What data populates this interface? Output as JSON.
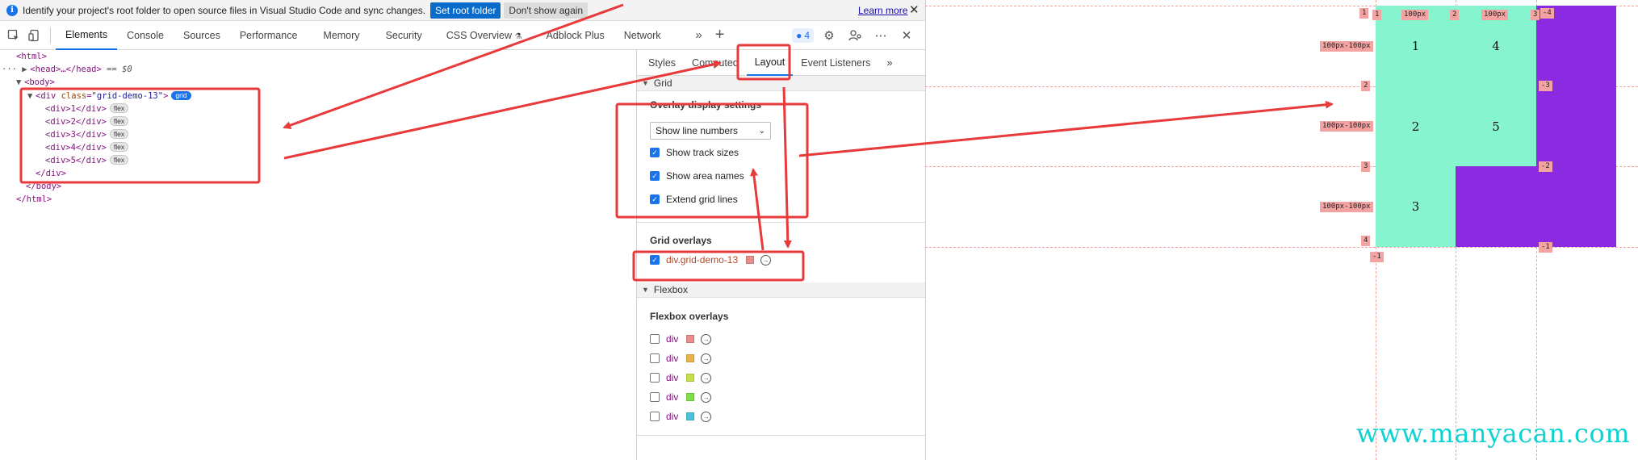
{
  "infobar": {
    "message": "Identify your project's root folder to open source files in Visual Studio Code and sync changes.",
    "set_root_label": "Set root folder",
    "dont_show_label": "Don't show again",
    "learn_more_label": "Learn more"
  },
  "toolbar": {
    "tabs": [
      "Elements",
      "Console",
      "Sources",
      "Performance",
      "Memory",
      "Security",
      "CSS Overview",
      "Adblock Plus",
      "Network"
    ],
    "active_tab": "Elements",
    "issues_count": "4"
  },
  "dom": {
    "html_open": "<html>",
    "head": "<head>…</head>",
    "selected_marker": "== $0",
    "body_open": "<body>",
    "div_tag_open": "<div ",
    "div_attr_name": "class",
    "div_attr_value": "\"grid-demo-13\"",
    "div_tag_close": ">",
    "grid_badge": "grid",
    "children": [
      "<div>1</div>",
      "<div>2</div>",
      "<div>3</div>",
      "<div>4</div>",
      "<div>5</div>"
    ],
    "flex_badge": "flex",
    "div_close": "</div>",
    "body_close": "</body>",
    "html_close": "</html>"
  },
  "sidebar": {
    "tabs": [
      "Styles",
      "Computed",
      "Layout",
      "Event Listeners"
    ],
    "active_tab": "Layout",
    "grid_section": "Grid",
    "overlay_title": "Overlay display settings",
    "line_select_value": "Show line numbers",
    "checkboxes": [
      {
        "label": "Show track sizes",
        "checked": true
      },
      {
        "label": "Show area names",
        "checked": true
      },
      {
        "label": "Extend grid lines",
        "checked": true
      }
    ],
    "grid_overlays_title": "Grid overlays",
    "grid_overlay_item": {
      "label": "div.grid-demo-13",
      "checked": true,
      "color": "#e88e8e"
    },
    "flexbox_section": "Flexbox",
    "flexbox_overlays_title": "Flexbox overlays",
    "flexbox_items": [
      {
        "label": "div",
        "color": "#e88e8e"
      },
      {
        "label": "div",
        "color": "#e9b44c"
      },
      {
        "label": "div",
        "color": "#c7e04a"
      },
      {
        "label": "div",
        "color": "#7fe04a"
      },
      {
        "label": "div",
        "color": "#49c3d9"
      }
    ]
  },
  "grid_demo": {
    "cells": [
      "1",
      "4",
      "2",
      "5",
      "3"
    ],
    "col_sizes": [
      "100px",
      "100px"
    ],
    "row_sizes": [
      "100px-100px",
      "100px-100px",
      "100px-100px"
    ],
    "col_line_numbers_top": [
      "1",
      "2",
      "3"
    ],
    "col_line_neg_top": "-4",
    "row_line_numbers_left": [
      "1",
      "2",
      "3",
      "4"
    ],
    "row_line_numbers_right": [
      "-3",
      "-2",
      "-1"
    ],
    "col_line_neg_bottom": "-1",
    "cell_color": "#86f5cf",
    "implicit_color": "#8a2be2"
  },
  "watermark": "www.manyacan.com",
  "colors": {
    "annotation_red": "#e8393b",
    "accent_blue": "#1a73e8"
  }
}
